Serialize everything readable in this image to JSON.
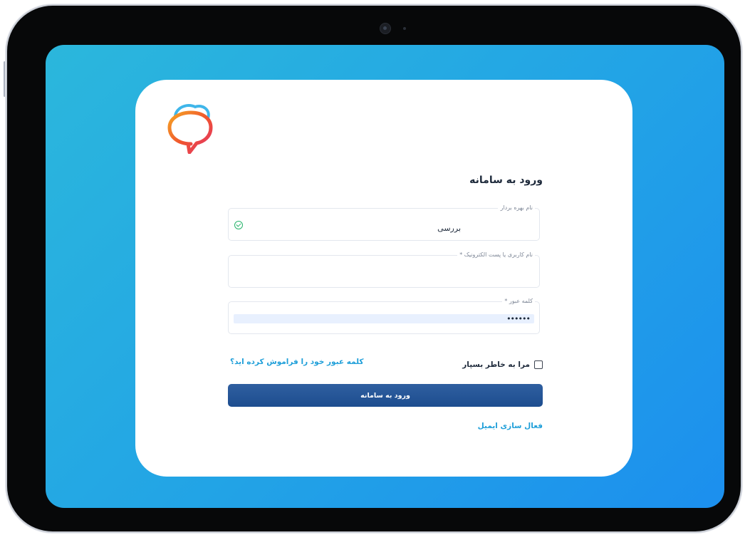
{
  "colors": {
    "screen_gradient_start": "#2bb7dc",
    "screen_gradient_end": "#1c8fee",
    "primary_button": "#245592",
    "link": "#1f9fd9",
    "success": "#27b46b"
  },
  "logo": {
    "icon": "chat-bubble-cloud-logo"
  },
  "login": {
    "title": "ورود به سامانه",
    "beneficiary": {
      "label": "نام بهره بردار",
      "value": "بررسی",
      "status_icon": "check-circle-icon"
    },
    "username": {
      "label": "نام کاربری یا پست الکترونیک *",
      "value": ""
    },
    "password": {
      "label": "کلمه عبور *",
      "value": "••••••"
    },
    "remember_me": {
      "label": "مرا به خاطر بسپار",
      "checked": false
    },
    "forgot_password": "کلمه عبور خود را فراموش کرده اید؟",
    "submit": "ورود به سامانه",
    "activate_email": "فعال سازی ایمیل"
  }
}
